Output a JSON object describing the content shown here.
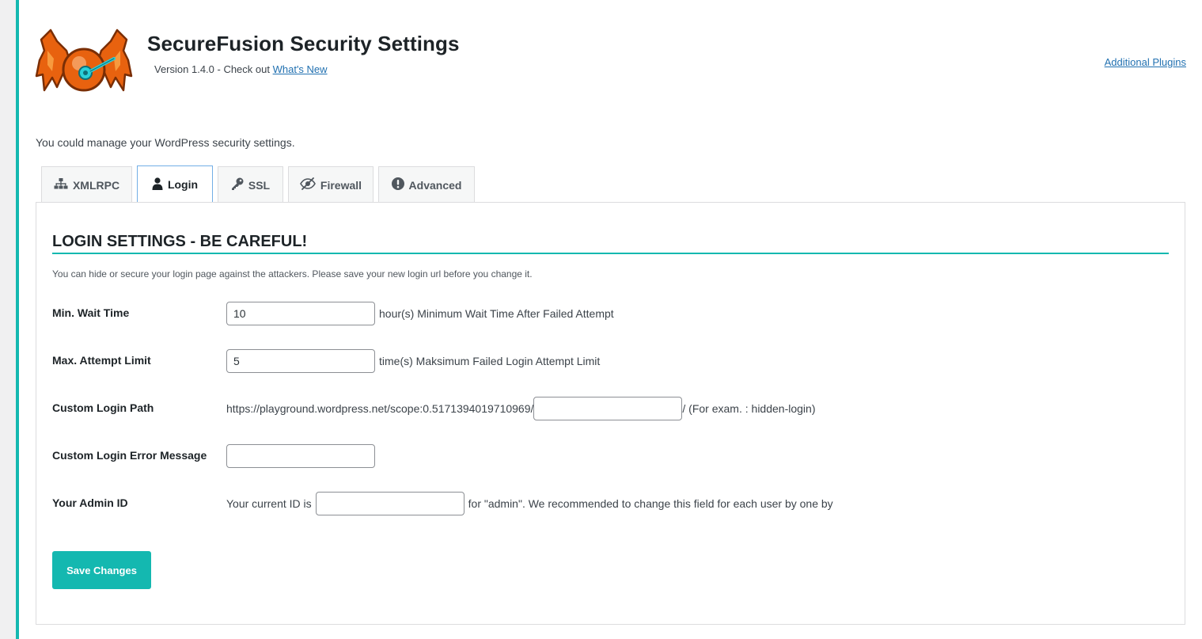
{
  "header": {
    "title": "SecureFusion Security Settings",
    "version_text": "Version 1.4.0 - Check out",
    "whats_new_link": "What's New",
    "additional_plugins_link": "Additional Plugins",
    "logo_icon": "securefusion-bat-lock-logo"
  },
  "intro": "You could manage your WordPress security settings.",
  "tabs": [
    {
      "label": "XMLRPC",
      "icon": "sitemap-icon"
    },
    {
      "label": "Login",
      "icon": "user-icon",
      "active": true
    },
    {
      "label": "SSL",
      "icon": "key-icon"
    },
    {
      "label": "Firewall",
      "icon": "eye-slash-icon"
    },
    {
      "label": "Advanced",
      "icon": "exclamation-circle-icon"
    }
  ],
  "panel": {
    "title": "LOGIN SETTINGS - BE CAREFUL!",
    "description": "You can hide or secure your login page against the attackers. Please save your new login url before you change it.",
    "fields": {
      "min_wait": {
        "label": "Min. Wait Time",
        "value": "10",
        "suffix": "hour(s) Minimum Wait Time After Failed Attempt"
      },
      "max_attempt": {
        "label": "Max. Attempt Limit",
        "value": "5",
        "suffix": "time(s) Maksimum Failed Login Attempt Limit"
      },
      "login_path": {
        "label": "Custom Login Path",
        "prefix": "https://playground.wordpress.net/scope:0.5171394019710969/",
        "value": "",
        "suffix": "/ (For exam. : hidden-login)"
      },
      "error_message": {
        "label": "Custom Login Error Message",
        "value": ""
      },
      "admin_id": {
        "label": "Your Admin ID",
        "prefix": "Your current ID is",
        "value": "",
        "suffix": "for \"admin\". We recommended to change this field for each user by one by"
      }
    },
    "save_label": "Save Changes"
  },
  "colors": {
    "accent": "#14b8b0",
    "link": "#2271b1",
    "logo_orange": "#e8620f",
    "logo_cyan": "#2ad1d9"
  }
}
